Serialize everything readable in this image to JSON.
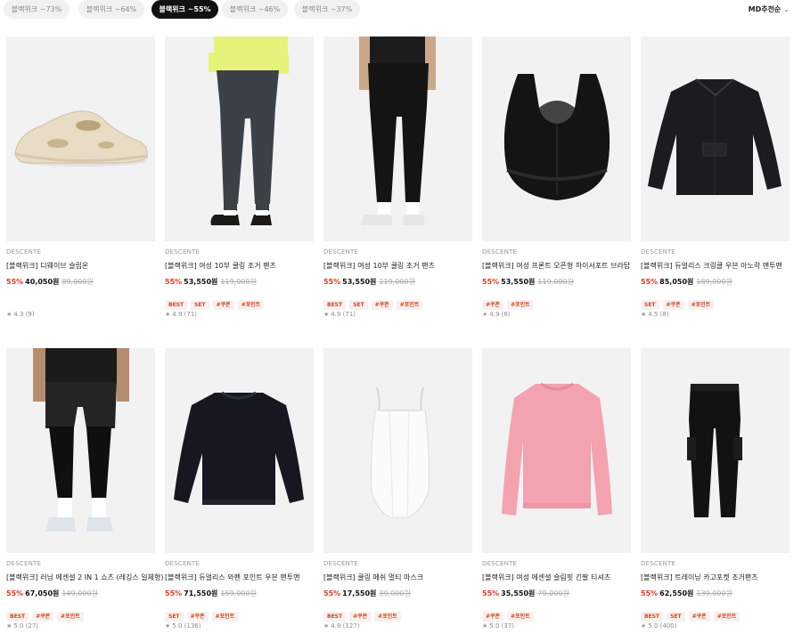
{
  "filters": [
    {
      "label": "블랙위크 ~73%",
      "active": false
    },
    {
      "label": "블랙위크 ~64%",
      "active": false
    },
    {
      "label": "블랙위크 ~55%",
      "active": true
    },
    {
      "label": "블랙위크 ~46%",
      "active": false
    },
    {
      "label": "블랙위크 ~37%",
      "active": false
    }
  ],
  "sort": {
    "label": "MD추천순",
    "icon": "chevron-down-icon"
  },
  "products": [
    {
      "brand": "DESCENTE",
      "name": "[블랙위크] 디웨이브 슬립온",
      "discount": "55%",
      "price": "40,050원",
      "original": "89,000원",
      "tags": [],
      "rating": "4.3 (9)",
      "image": "shoe-slipon"
    },
    {
      "brand": "DESCENTE",
      "name": "[블랙위크] 여성 10부 쿨링 조거 팬츠",
      "discount": "55%",
      "price": "53,550원",
      "original": "119,000원",
      "tags": [
        "BEST",
        "SET",
        "#쿠폰",
        "#포인트"
      ],
      "rating": "4.9 (71)",
      "image": "jogger-pants-grey"
    },
    {
      "brand": "DESCENTE",
      "name": "[블랙위크] 여성 10부 쿨링 조거 팬츠",
      "discount": "55%",
      "price": "53,550원",
      "original": "119,000원",
      "tags": [
        "BEST",
        "SET",
        "#쿠폰",
        "#포인트"
      ],
      "rating": "4.9 (71)",
      "image": "jogger-pants-black"
    },
    {
      "brand": "DESCENTE",
      "name": "[블랙위크] 여성 프론트 오픈형 하이서포트 브라탑",
      "discount": "55%",
      "price": "53,550원",
      "original": "119,000원",
      "tags": [
        "#쿠폰",
        "#포인트"
      ],
      "rating": "4.9 (8)",
      "image": "sports-bra"
    },
    {
      "brand": "DESCENTE",
      "name": "[블랙위크] 듀얼리스 크링클 우븐 아노락 맨투맨",
      "discount": "55%",
      "price": "85,050원",
      "original": "189,000원",
      "tags": [
        "SET",
        "#쿠폰",
        "#포인트"
      ],
      "rating": "4.5 (8)",
      "image": "anorak-jacket"
    },
    {
      "brand": "DESCENTE",
      "name": "[블랙위크] 러닝 에센셜 2 IN 1 쇼츠 (레깅스 일체형)",
      "discount": "55%",
      "price": "67,050원",
      "original": "149,000원",
      "tags": [
        "BEST",
        "#쿠폰",
        "#포인트"
      ],
      "rating": "5.0 (27)",
      "image": "running-shorts"
    },
    {
      "brand": "DESCENTE",
      "name": "[블랙위크] 듀얼리스 와펜 포인트 우븐 맨투맨",
      "discount": "55%",
      "price": "71,550원",
      "original": "159,000원",
      "tags": [
        "SET",
        "#쿠폰",
        "#포인트"
      ],
      "rating": "5.0 (136)",
      "image": "sweatshirt"
    },
    {
      "brand": "DESCENTE",
      "name": "[블랙위크] 쿨링 메쉬 멀티 마스크",
      "discount": "55%",
      "price": "17,550원",
      "original": "39,000원",
      "tags": [
        "BEST",
        "#쿠폰",
        "#포인트"
      ],
      "rating": "4.9 (127)",
      "image": "mesh-mask"
    },
    {
      "brand": "DESCENTE",
      "name": "[블랙위크] 여성 에센셜 슬림핏 긴팔 티셔츠",
      "discount": "55%",
      "price": "35,550원",
      "original": "79,000원",
      "tags": [
        "#쿠폰",
        "#포인트"
      ],
      "rating": "5.0 (37)",
      "image": "pink-longsleeve"
    },
    {
      "brand": "DESCENTE",
      "name": "[블랙위크] 트레이닝 카고포켓 조거팬츠",
      "discount": "55%",
      "price": "62,550원",
      "original": "139,000원",
      "tags": [
        "BEST",
        "SET",
        "#쿠폰",
        "#포인트"
      ],
      "rating": "5.0 (400)",
      "image": "cargo-pants"
    }
  ]
}
